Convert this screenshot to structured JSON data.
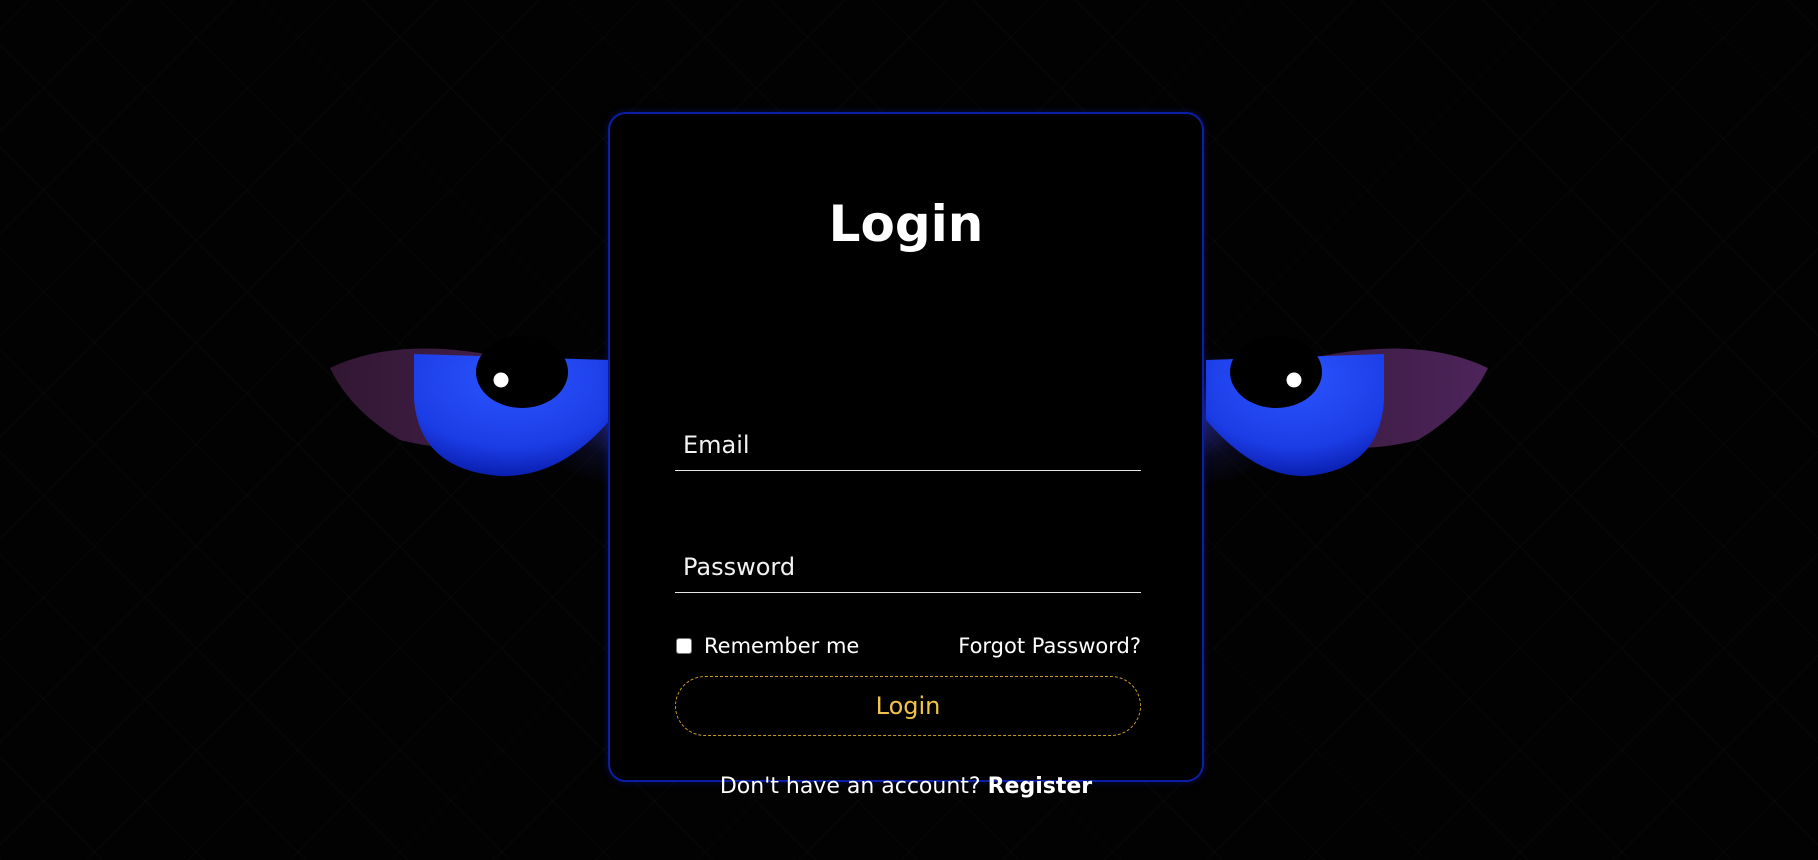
{
  "login_form": {
    "title": "Login",
    "email_placeholder": "Email",
    "password_placeholder": "Password",
    "remember_label": "Remember me",
    "forgot_label": "Forgot Password?",
    "submit_label": "Login",
    "register_prompt": "Don't have an account?",
    "register_link": "Register"
  },
  "colors": {
    "background": "#000000",
    "card_border": "#0b1ea8",
    "button_accent": "#f2c34a",
    "eye_iris": "#1f3dff"
  },
  "icons": [
    "eye-left-icon",
    "eye-right-icon"
  ]
}
